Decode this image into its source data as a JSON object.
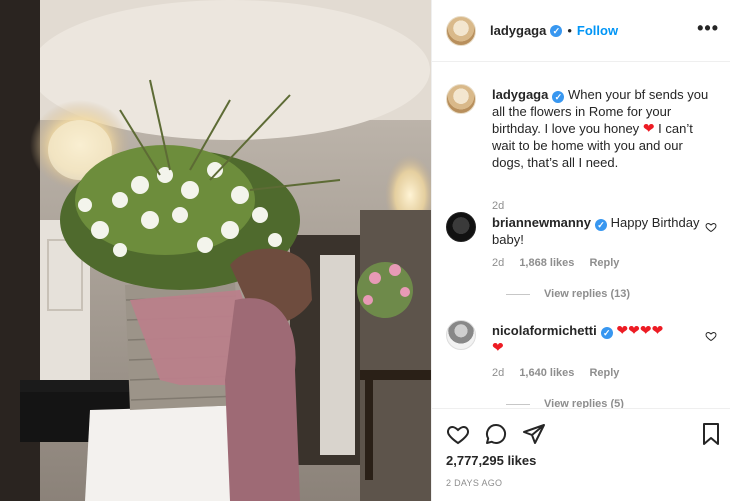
{
  "post": {
    "photo_alt": "woman hugging large basket of flowers"
  },
  "header": {
    "username": "ladygaga",
    "separator": "•",
    "follow_label": "Follow",
    "more_label": "•••"
  },
  "caption": {
    "username": "ladygaga",
    "text": "When your bf sends you all the flowers in Rome for your birthday. I love you honey",
    "text2": " I can’t wait to be home with you and our dogs, that’s all I need.",
    "heart": "❤",
    "time": "2d"
  },
  "comments": [
    {
      "username": "briannewmanny",
      "text": "Happy Birthday baby!",
      "time": "2d",
      "likes": "1,868 likes",
      "reply": "Reply",
      "view_replies": "View replies (13)"
    },
    {
      "username": "nicolaformichetti",
      "hearts": "❤❤❤❤",
      "hearts2": "❤",
      "time": "2d",
      "likes": "1,640 likes",
      "reply": "Reply",
      "view_replies": "View replies (5)"
    }
  ],
  "footer": {
    "likes": "2,777,295 likes",
    "posted": "2 DAYS AGO"
  },
  "icons": {
    "verified": "✓",
    "like": "heart-outline-icon",
    "comment": "comment-icon",
    "share": "paper-plane-icon",
    "save": "bookmark-icon"
  },
  "colors": {
    "verified": "#3897f0",
    "follow": "#0095f6",
    "heart_emoji": "#ed1c24",
    "muted": "#8e8e8e"
  }
}
